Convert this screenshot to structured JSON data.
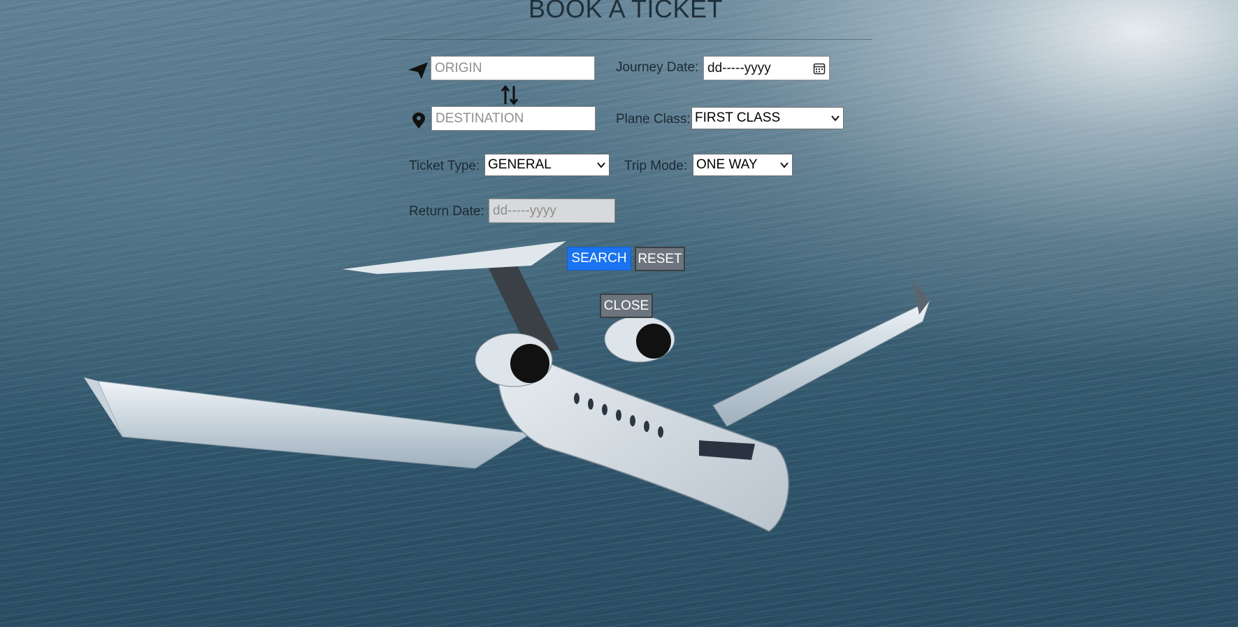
{
  "page": {
    "title": "BOOK A TICKET"
  },
  "form": {
    "origin": {
      "placeholder": "ORIGIN",
      "value": ""
    },
    "destination": {
      "placeholder": "DESTINATION",
      "value": ""
    },
    "journey_date": {
      "label": "Journey Date:",
      "value": "dd-----yyyy"
    },
    "plane_class": {
      "label": "Plane Class:",
      "selected": "FIRST CLASS"
    },
    "ticket_type": {
      "label": "Ticket Type:",
      "selected": "GENERAL"
    },
    "trip_mode": {
      "label": "Trip Mode:",
      "selected": "ONE WAY"
    },
    "return_date": {
      "label": "Return Date:",
      "value": "dd-----yyyy",
      "disabled": true
    }
  },
  "buttons": {
    "search": "SEARCH",
    "reset": "RESET",
    "close": "CLOSE"
  },
  "icons": {
    "origin": "paper-plane-icon",
    "destination": "map-pin-icon",
    "swap": "swap-vertical-icon",
    "calendar": "calendar-icon"
  },
  "colors": {
    "primary_button": "#1a73f0",
    "secondary_button": "#6c757d"
  }
}
